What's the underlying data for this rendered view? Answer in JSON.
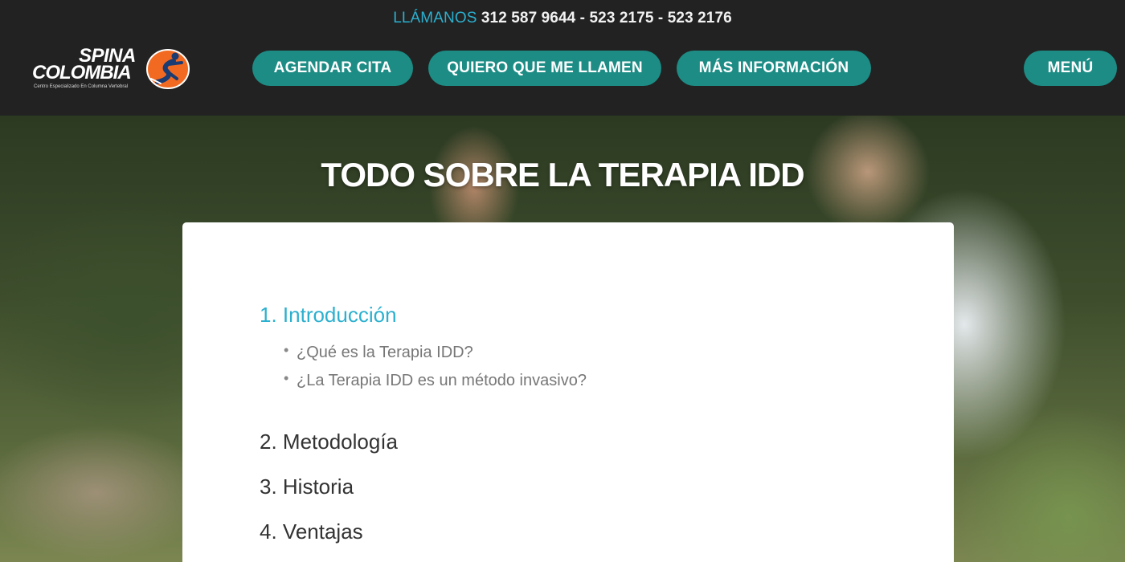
{
  "header": {
    "call_label": "LLÁMANOS",
    "phones": [
      "312 587 9644",
      "523 2175",
      "523 2176"
    ],
    "separator": " - ",
    "logo": {
      "line1": "SPINA",
      "line2": "COLOMBIA",
      "tagline": "Centro Especializado En Columna Vertebral",
      "badge_icon": "runner-icon"
    },
    "nav": {
      "agendar": "AGENDAR CITA",
      "llamen": "QUIERO QUE ME LLAMEN",
      "info": "MÁS INFORMACIÓN",
      "menu": "MENÚ"
    }
  },
  "hero": {
    "title": "TODO SOBRE LA TERAPIA IDD"
  },
  "toc": {
    "section1": {
      "label": "1. Introducción",
      "items": [
        "¿Qué es la Terapia IDD?",
        "¿La Terapia IDD es un método invasivo?"
      ]
    },
    "section2": "2. Metodología",
    "section3": "3. Historia",
    "section4": "4. Ventajas"
  },
  "colors": {
    "header_bg": "#222222",
    "accent_teal": "#1c8c85",
    "link_blue": "#2bb0cf",
    "logo_orange": "#f26a21"
  }
}
